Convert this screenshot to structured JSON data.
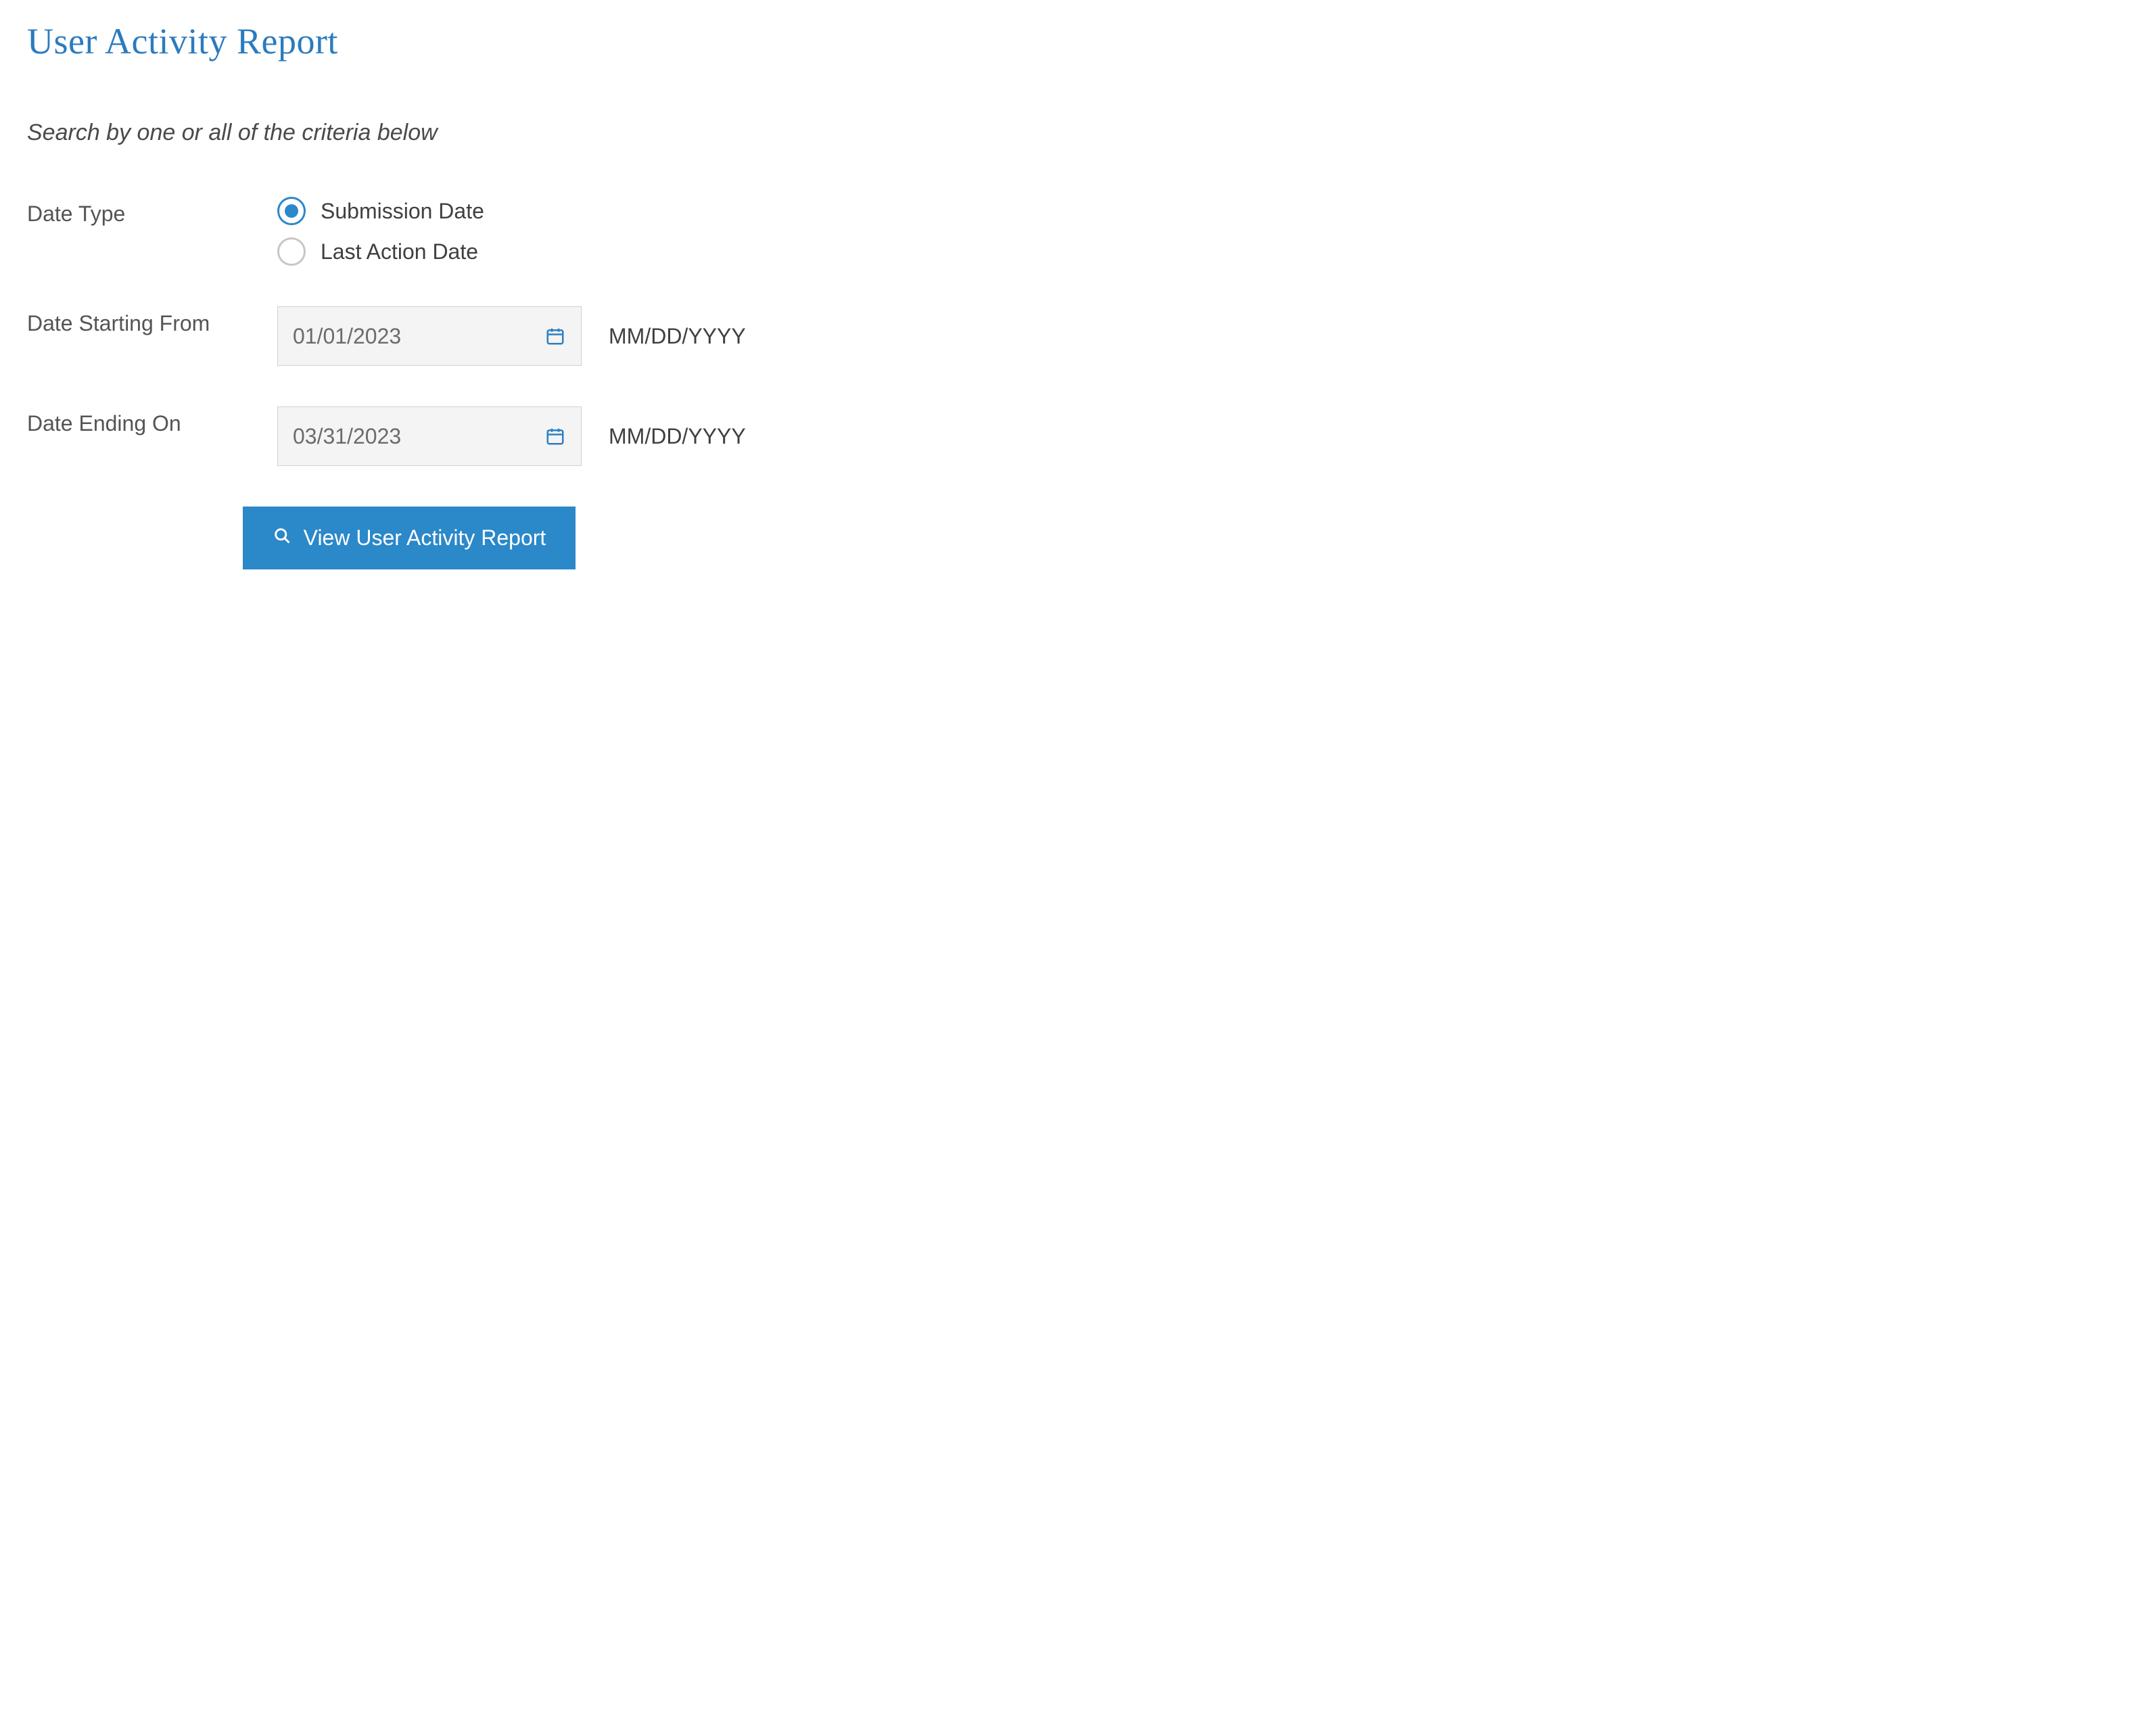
{
  "title": "User Activity Report",
  "subtitle": "Search by one or all of the criteria below",
  "form": {
    "date_type": {
      "label": "Date Type",
      "options": [
        {
          "label": "Submission Date",
          "checked": true
        },
        {
          "label": "Last Action Date",
          "checked": false
        }
      ]
    },
    "date_start": {
      "label": "Date Starting From",
      "value": "01/01/2023",
      "hint": "MM/DD/YYYY"
    },
    "date_end": {
      "label": "Date Ending On",
      "value": "03/31/2023",
      "hint": "MM/DD/YYYY"
    }
  },
  "button_label": "View User Activity Report"
}
